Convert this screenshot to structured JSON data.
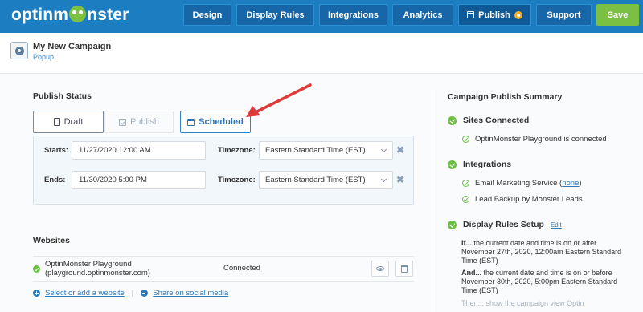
{
  "nav": {
    "logo_left": "optinm",
    "logo_right": "nster",
    "design": "Design",
    "display_rules": "Display Rules",
    "integrations": "Integrations",
    "analytics": "Analytics",
    "publish": "Publish",
    "support": "Support",
    "save": "Save"
  },
  "campaign": {
    "title": "My New Campaign",
    "type": "Popup"
  },
  "publish_status": {
    "title": "Publish Status",
    "draft": "Draft",
    "publish": "Publish",
    "scheduled": "Scheduled",
    "active": "Scheduled"
  },
  "schedule": {
    "starts_label": "Starts:",
    "starts_value": "11/27/2020 12:00 AM",
    "ends_label": "Ends:",
    "ends_value": "11/30/2020 5:00 PM",
    "timezone_label": "Timezone:",
    "start_timezone": "Eastern Standard Time (EST)",
    "end_timezone": "Eastern Standard Time (EST)",
    "remove": "✖"
  },
  "websites": {
    "title": "Websites",
    "site_name": "OptinMonster Playground",
    "site_domain": "(playground.optinmonster.com)",
    "site_status": "Connected",
    "select_link": "Select or add a website",
    "share_link": "Share on social media"
  },
  "summary": {
    "title": "Campaign Publish Summary",
    "sites_connected": "Sites Connected",
    "site_item": "OptinMonster Playground is connected",
    "integrations": "Integrations",
    "email_item_prefix": "Email Marketing Service (",
    "email_item_link": "none",
    "email_item_suffix": ")",
    "lead_item": "Lead Backup by Monster Leads",
    "display_rules": "Display Rules Setup",
    "edit": "Edit",
    "rule1_lead": "If...",
    "rule1_text": " the current date and time is on or after November 27th, 2020, 12:00am Eastern Standard Time (EST)",
    "rule2_lead": "And...",
    "rule2_text": " the current date and time is on or before November 30th, 2020, 5:00pm Eastern Standard Time (EST)",
    "rule3_text": "Then... show the campaign view Optin"
  },
  "colors": {
    "topbar": "#1c7ec1",
    "save": "#7cc043",
    "accent": "#2f78b7",
    "success": "#6cbe45",
    "arrow": "#e0393a",
    "publish_badge": "#f5b021"
  }
}
